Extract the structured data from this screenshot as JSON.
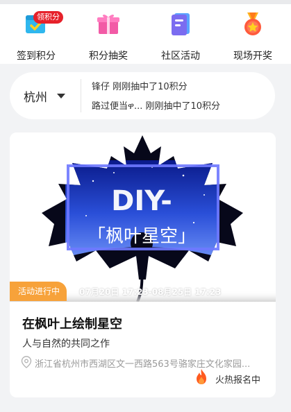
{
  "quick_nav": [
    {
      "label": "签到积分",
      "icon": "checkin-calendar-icon",
      "badge": "领积分"
    },
    {
      "label": "积分抽奖",
      "icon": "gift-box-icon"
    },
    {
      "label": "社区活动",
      "icon": "document-icon"
    },
    {
      "label": "现场开奖",
      "icon": "medal-icon"
    }
  ],
  "city_selector": {
    "city": "杭州"
  },
  "ticker": [
    "锋仔 刚刚抽中了10积分",
    "路过便当ዋ... 刚刚抽中了10积分"
  ],
  "activity": {
    "poster_title": "DIY-",
    "poster_subtitle": "「枫叶星空」",
    "status": "活动进行中",
    "date_range": "07月20日 17:23-08月25日 17:23",
    "title": "在枫叶上绘制星空",
    "subtitle": "人与自然的共同之作",
    "address": "浙江省杭州市西湖区文一西路563号骆家庄文化家园...",
    "hot_label": "火热报名中"
  },
  "colors": {
    "accent_orange": "#f7a23a",
    "badge_red": "#e6212a",
    "fire": "#ff5a1f"
  }
}
